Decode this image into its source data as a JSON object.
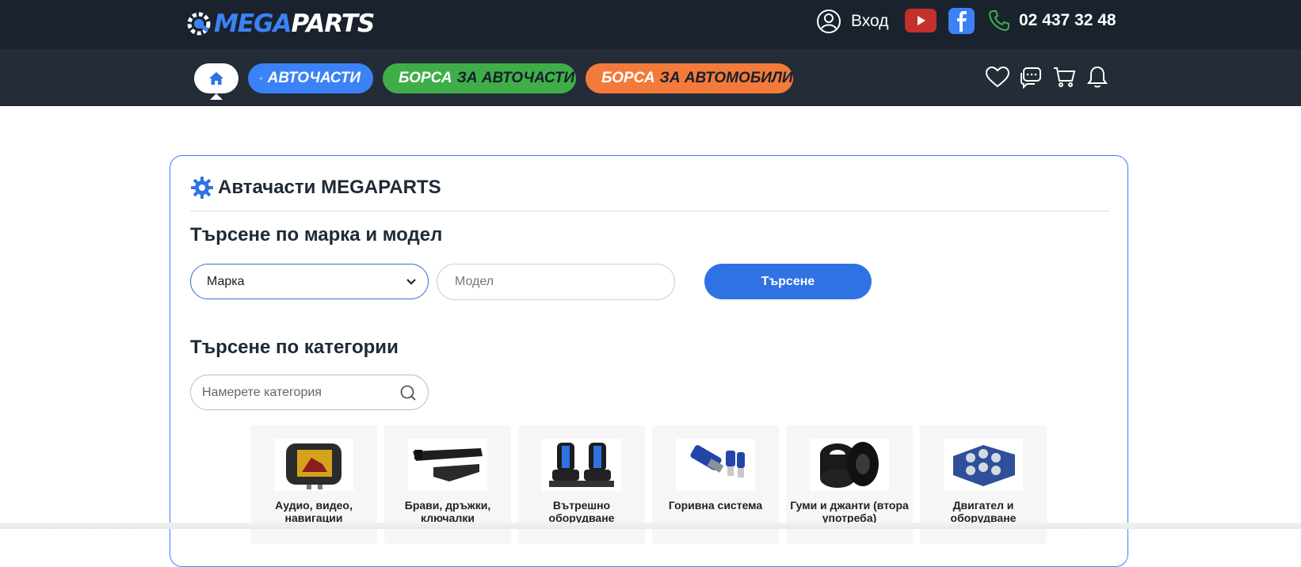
{
  "brand": {
    "logo_left": "MEGA",
    "logo_right": "PARTS"
  },
  "header": {
    "login_label": "Вход",
    "phone": "02 437 32 48",
    "youtube_icon": "youtube-icon",
    "facebook_icon": "facebook-icon"
  },
  "nav": {
    "parts_label": "АВТОЧАСТИ",
    "exchange_parts": {
      "a": "БОРСА",
      "b": "ЗА АВТОЧАСТИ"
    },
    "exchange_cars": {
      "a": "БОРСА",
      "b": "ЗА АВТОМОБИЛИ"
    },
    "colors": {
      "parts": "#3b82f6",
      "exchange_parts": "#3fae49",
      "exchange_cars": "#f37a3b"
    }
  },
  "card": {
    "title": "Автачасти MEGAPARTS",
    "search_by_model_heading": "Търсене по марка и модел",
    "brand_select": "Марка",
    "model_placeholder": "Модел",
    "search_button": "Търсене",
    "search_by_category_heading": "Търсене по категории",
    "category_search_placeholder": "Намерете категория"
  },
  "categories": [
    {
      "label": "Аудио, видео, навигации",
      "icon": "headrest-monitor"
    },
    {
      "label": "Брави, дръжки, ключалки",
      "icon": "door-handle"
    },
    {
      "label": "Вътрешно оборудване",
      "icon": "car-seat"
    },
    {
      "label": "Горивна система",
      "icon": "fuel-injector"
    },
    {
      "label": "Гуми и джанти (втора употреба)",
      "icon": "tires"
    },
    {
      "label": "Двигател и оборудване",
      "icon": "engine-block"
    }
  ]
}
